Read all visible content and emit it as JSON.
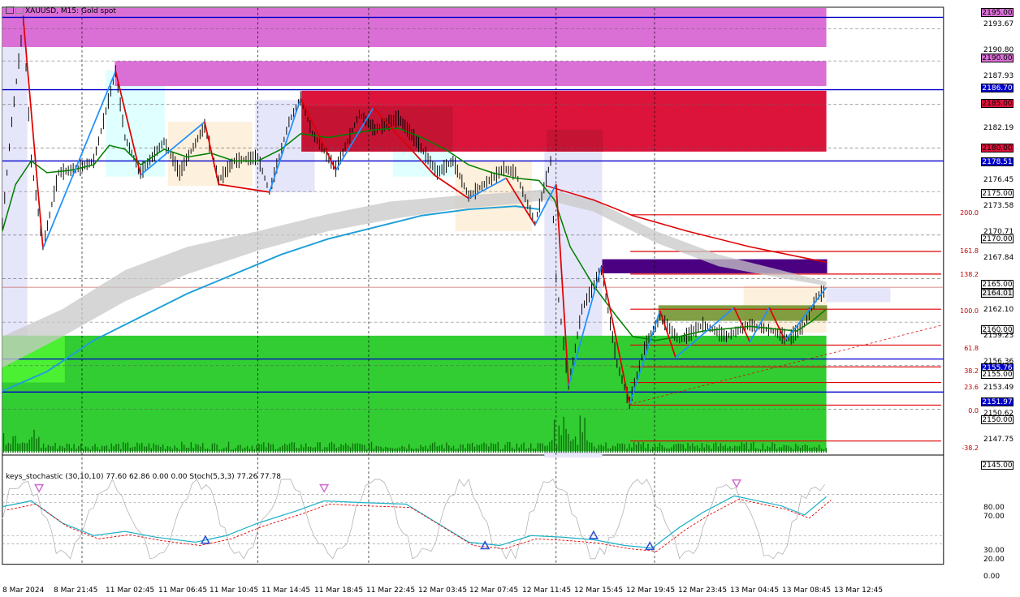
{
  "window": {
    "title": "XAUUSD, M15:  Gold spot"
  },
  "price_axis": {
    "labels": [
      "2195.00",
      "2193.67",
      "2190.80",
      "2190.00",
      "2187.93",
      "2186.70",
      "2185.00",
      "2182.19",
      "2180.00",
      "2178.51",
      "2176.45",
      "2175.00",
      "2173.58",
      "2170.71",
      "2170.00",
      "2167.84",
      "2165.00",
      "2164.01",
      "2162.10",
      "2160.00",
      "2159.23",
      "2156.36",
      "2155.76",
      "2155.00",
      "2153.49",
      "2151.97",
      "2150.62",
      "2150.00",
      "2147.75",
      "2145.00"
    ],
    "tagged": [
      "2195.00",
      "2190.00",
      "2186.70",
      "2185.00",
      "2180.00",
      "2178.51",
      "2175.00",
      "2170.00",
      "2165.00",
      "2164.01",
      "2160.00",
      "2155.76",
      "2155.00",
      "2151.97",
      "2150.00",
      "2145.00"
    ]
  },
  "fib_levels": [
    "200.0",
    "161.8",
    "138.2",
    "100.0",
    "61.8",
    "38.2",
    "23.6",
    "0.0",
    "-38.2"
  ],
  "stochastic": {
    "title": "keys_stochastic (30,10,10) 77.60 62.86 0.00 0.00 Stoch(5,3,3) 77.26 77.78",
    "levels": [
      "80.00",
      "70.00",
      "30.00",
      "20.00",
      "0.00"
    ]
  },
  "time_axis": [
    "8 Mar 2024",
    "8 Mar 21:45",
    "11 Mar 02:45",
    "11 Mar 06:45",
    "11 Mar 10:45",
    "11 Mar 14:45",
    "11 Mar 18:45",
    "11 Mar 22:45",
    "12 Mar 03:45",
    "12 Mar 07:45",
    "12 Mar 11:45",
    "12 Mar 15:45",
    "12 Mar 19:45",
    "12 Mar 23:45",
    "13 Mar 04:45",
    "13 Mar 08:45",
    "13 Mar 12:45"
  ],
  "colors": {
    "magenta_zone": "#da70d6",
    "red_zone": "#dc143c",
    "green_zone": "#32cd32",
    "blue_line": "#0000cd",
    "ma_green": "#008000",
    "ma_cyan": "#1e9fd8",
    "zigzag_red": "#e00000",
    "zigzag_blue": "#1e90ff",
    "purple_zone": "#4b0082"
  }
}
